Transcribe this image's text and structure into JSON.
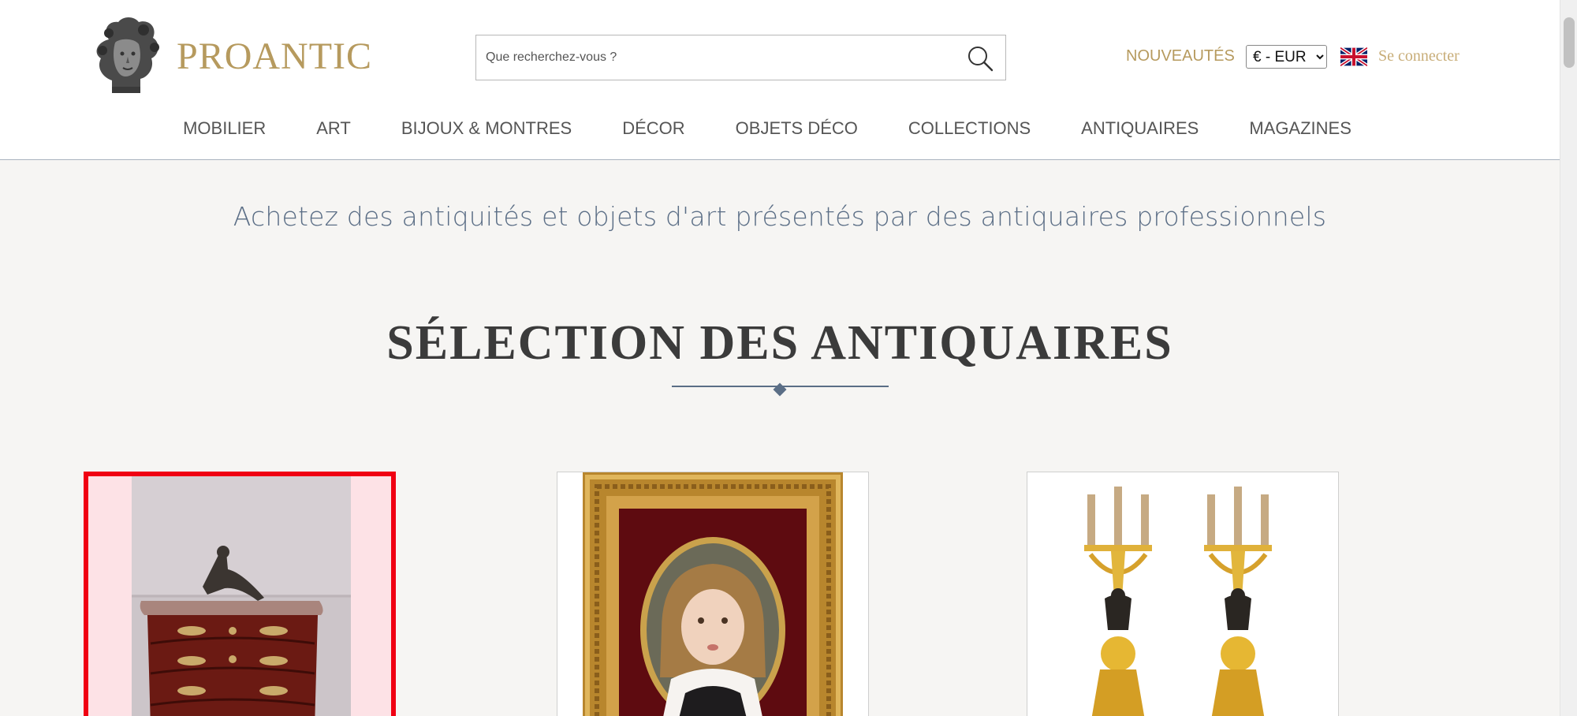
{
  "header": {
    "logo_text": "PROANTIC",
    "search_placeholder": "Que recherchez-vous ?",
    "new_label": "NOUVEAUTÉS",
    "currency_selected": "€ - EUR",
    "login_label": "Se connecter",
    "language_flag": "uk-flag-icon"
  },
  "nav": {
    "items": [
      "MOBILIER",
      "ART",
      "BIJOUX & MONTRES",
      "DÉCOR",
      "OBJETS DÉCO",
      "COLLECTIONS",
      "ANTIQUAIRES",
      "MAGAZINES"
    ]
  },
  "main": {
    "tagline": "Achetez des antiquités et objets d'art présentés par des antiquaires professionnels",
    "section_title": "SÉLECTION DES ANTIQUAIRES"
  },
  "colors": {
    "brand_gold": "#b69a5e",
    "slate_blue": "#5b6e86",
    "highlight_red": "#f00013"
  }
}
